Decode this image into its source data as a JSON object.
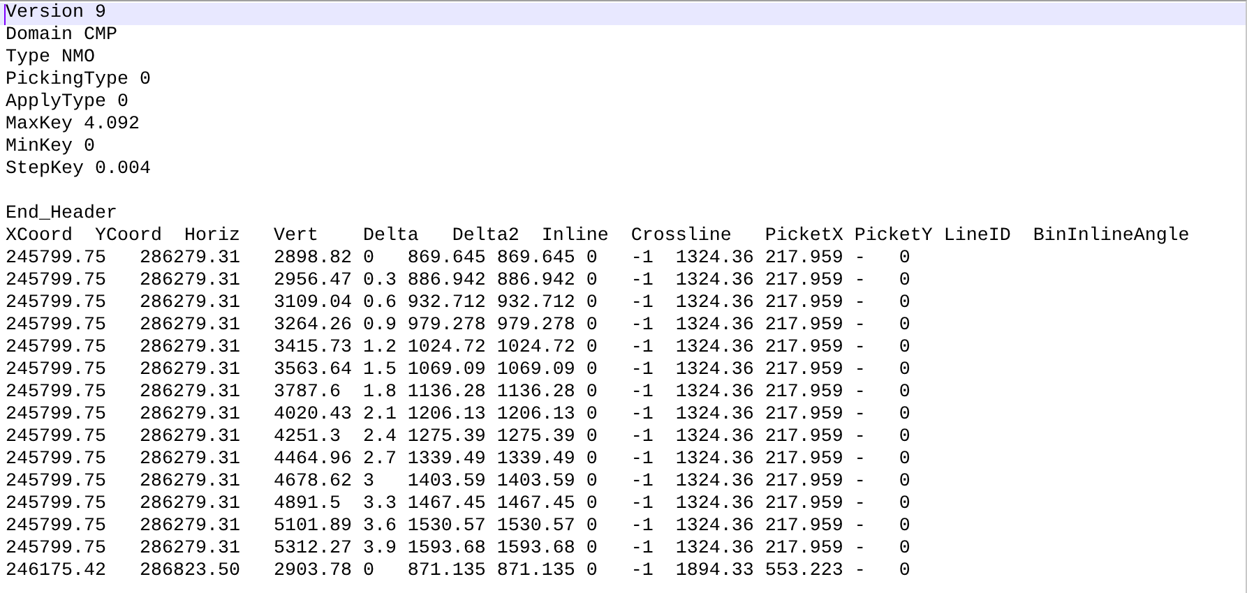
{
  "editor": {
    "lines": [
      {
        "kind": "text",
        "text": "Version 9",
        "current": true
      },
      {
        "kind": "text",
        "text": "Domain CMP",
        "current": false
      },
      {
        "kind": "text",
        "text": "Type NMO",
        "current": false
      },
      {
        "kind": "text",
        "text": "PickingType 0",
        "current": false
      },
      {
        "kind": "text",
        "text": "ApplyType 0",
        "current": false
      },
      {
        "kind": "text",
        "text": "MaxKey 4.092",
        "current": false
      },
      {
        "kind": "text",
        "text": "MinKey 0",
        "current": false
      },
      {
        "kind": "text",
        "text": "StepKey 0.004",
        "current": false
      },
      {
        "kind": "blank"
      },
      {
        "kind": "text",
        "text": "End_Header",
        "current": false
      },
      {
        "kind": "text",
        "text": "XCoord  YCoord  Horiz   Vert    Delta   Delta2  Inline  Crossline   PicketX PicketY LineID  BinInlineAngle",
        "current": false
      },
      {
        "kind": "text",
        "text": "245799.75   286279.31   2898.82 0   869.645 869.645 0   -1  1324.36 217.959 -   0",
        "current": false
      },
      {
        "kind": "text",
        "text": "245799.75   286279.31   2956.47 0.3 886.942 886.942 0   -1  1324.36 217.959 -   0",
        "current": false
      },
      {
        "kind": "text",
        "text": "245799.75   286279.31   3109.04 0.6 932.712 932.712 0   -1  1324.36 217.959 -   0",
        "current": false
      },
      {
        "kind": "text",
        "text": "245799.75   286279.31   3264.26 0.9 979.278 979.278 0   -1  1324.36 217.959 -   0",
        "current": false
      },
      {
        "kind": "text",
        "text": "245799.75   286279.31   3415.73 1.2 1024.72 1024.72 0   -1  1324.36 217.959 -   0",
        "current": false
      },
      {
        "kind": "text",
        "text": "245799.75   286279.31   3563.64 1.5 1069.09 1069.09 0   -1  1324.36 217.959 -   0",
        "current": false
      },
      {
        "kind": "text",
        "text": "245799.75   286279.31   3787.6  1.8 1136.28 1136.28 0   -1  1324.36 217.959 -   0",
        "current": false
      },
      {
        "kind": "text",
        "text": "245799.75   286279.31   4020.43 2.1 1206.13 1206.13 0   -1  1324.36 217.959 -   0",
        "current": false
      },
      {
        "kind": "text",
        "text": "245799.75   286279.31   4251.3  2.4 1275.39 1275.39 0   -1  1324.36 217.959 -   0",
        "current": false
      },
      {
        "kind": "text",
        "text": "245799.75   286279.31   4464.96 2.7 1339.49 1339.49 0   -1  1324.36 217.959 -   0",
        "current": false
      },
      {
        "kind": "text",
        "text": "245799.75   286279.31   4678.62 3   1403.59 1403.59 0   -1  1324.36 217.959 -   0",
        "current": false
      },
      {
        "kind": "text",
        "text": "245799.75   286279.31   4891.5  3.3 1467.45 1467.45 0   -1  1324.36 217.959 -   0",
        "current": false
      },
      {
        "kind": "text",
        "text": "245799.75   286279.31   5101.89 3.6 1530.57 1530.57 0   -1  1324.36 217.959 -   0",
        "current": false
      },
      {
        "kind": "text",
        "text": "245799.75   286279.31   5312.27 3.9 1593.68 1593.68 0   -1  1324.36 217.959 -   0",
        "current": false
      },
      {
        "kind": "text",
        "text": "246175.42   286823.50   2903.78 0   871.135 871.135 0   -1  1894.33 553.223 -   0",
        "current": false
      }
    ]
  }
}
